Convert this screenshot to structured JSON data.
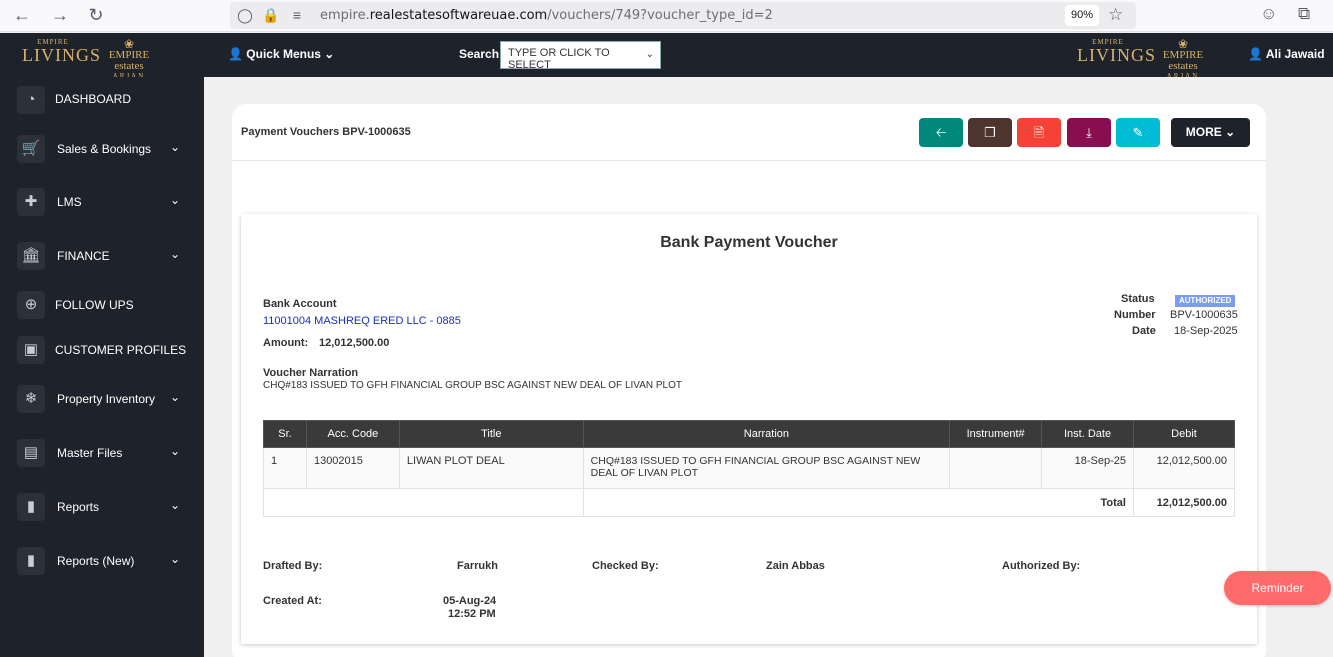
{
  "browser": {
    "url_prefix": "empire.",
    "url_domain": "realestatesoftwareuae.com",
    "url_path": "/vouchers/749?voucher_type_id=2",
    "zoom": "90%"
  },
  "header": {
    "logo_empire_small": "EMPIRE",
    "logo_empire_large": "LIVINGS",
    "logo_estates_main": "EMPIRE estates",
    "logo_estates_sub": "ARJAN",
    "quick_menus": "Quick Menus",
    "search_label": "Search",
    "search_placeholder": "TYPE OR CLICK TO SELECT",
    "user_name": "Ali Jawaid"
  },
  "sidebar": {
    "items": [
      {
        "label": "DASHBOARD",
        "icon": "pie-chart-icon",
        "has_chevron": false
      },
      {
        "label": "Sales & Bookings",
        "icon": "cart-icon",
        "has_chevron": true
      },
      {
        "label": "LMS",
        "icon": "lms-icon",
        "has_chevron": true
      },
      {
        "label": "FINANCE",
        "icon": "bank-icon",
        "has_chevron": true
      },
      {
        "label": "FOLLOW UPS",
        "icon": "plus-circle-icon",
        "has_chevron": false
      },
      {
        "label": "CUSTOMER PROFILES",
        "icon": "id-card-icon",
        "has_chevron": false
      },
      {
        "label": "Property Inventory",
        "icon": "snowflake-icon",
        "has_chevron": true
      },
      {
        "label": "Master Files",
        "icon": "image-icon",
        "has_chevron": true
      },
      {
        "label": "Reports",
        "icon": "bar-chart-icon",
        "has_chevron": true
      },
      {
        "label": "Reports (New)",
        "icon": "bar-chart-icon",
        "has_chevron": true
      }
    ]
  },
  "card": {
    "title": "Payment Vouchers BPV-1000635",
    "toolbar": {
      "back_color": "#00897b",
      "copy_color": "#4e342e",
      "pdf_color": "#f44336",
      "download_color": "#880e4f",
      "edit_color": "#00bcd4",
      "more_label": "MORE"
    }
  },
  "voucher": {
    "title": "Bank Payment Voucher",
    "bank_account_label": "Bank Account",
    "bank_account_value": "11001004 MASHREQ ERED LLC - 0885",
    "amount_label": "Amount:",
    "amount_value": "12,012,500.00",
    "status_label": "Status",
    "status_value": "AUTHORIZED",
    "number_label": "Number",
    "number_value": "BPV-1000635",
    "date_label": "Date",
    "date_value": "18-Sep-2025",
    "narration_label": "Voucher Narration",
    "narration_value": "CHQ#183 ISSUED TO GFH FINANCIAL GROUP BSC AGAINST NEW DEAL OF LIVAN PLOT",
    "table": {
      "headers": [
        "Sr.",
        "Acc. Code",
        "Title",
        "Narration",
        "Instrument#",
        "Inst. Date",
        "Debit"
      ],
      "rows": [
        {
          "sr": "1",
          "acc_code": "13002015",
          "title": "LIWAN PLOT DEAL",
          "narration": "CHQ#183 ISSUED TO GFH FINANCIAL GROUP BSC AGAINST NEW DEAL OF LIVAN PLOT",
          "instrument": "",
          "inst_date": "18-Sep-25",
          "debit": "12,012,500.00"
        }
      ],
      "total_label": "Total",
      "total_value": "12,012,500.00"
    },
    "drafted_by_label": "Drafted By:",
    "drafted_by_value": "Farrukh",
    "checked_by_label": "Checked By:",
    "checked_by_value": "Zain Abbas",
    "authorized_by_label": "Authorized By:",
    "created_at_label": "Created At:",
    "created_at_date": "05-Aug-24",
    "created_at_time": "12:52 PM"
  },
  "reminder_label": "Reminder"
}
